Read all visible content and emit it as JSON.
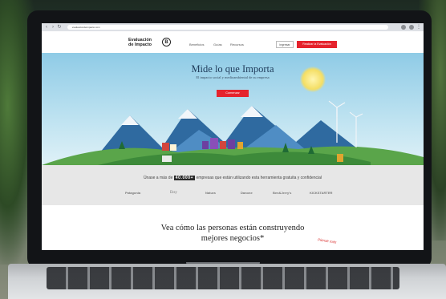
{
  "browser": {
    "url": "evaluaciondeimpacto.com"
  },
  "header": {
    "logo_line1": "Evaluación",
    "logo_line2": "de Impacto",
    "logo_mark": "B",
    "nav": [
      "Beneficios",
      "Guías",
      "Recursos"
    ],
    "login_label": "Ingresar",
    "start_label": "Realizar la Evaluación"
  },
  "hero": {
    "title": "Mide lo que Importa",
    "subtitle": "El impacto social y medioambiental de su empresa",
    "cta_label": "Comenzar"
  },
  "trust": {
    "text_before": "Únase a más de",
    "count": "40.000+",
    "text_after": "empresas que están utilizando esta herramienta gratuita y confidencial",
    "partners": [
      "Patagonia",
      "Etsy",
      "Natura",
      "Danone",
      "Ben&Jerry's",
      "KICKSTARTER"
    ]
  },
  "testimonial": {
    "title_line1": "Vea cómo las personas están construyendo",
    "title_line2": "mejores negocios*",
    "note": "Piense más"
  },
  "colors": {
    "accent": "#e5232d",
    "sky": "#8fcbe6",
    "band": "#e7e7e7"
  }
}
